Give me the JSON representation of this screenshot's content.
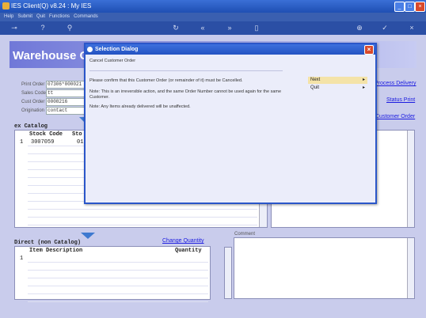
{
  "window": {
    "title": "IES Client(Q) v8.24 : My IES"
  },
  "menu": [
    "Help",
    "Submit",
    "Quit",
    "Functions",
    "Commands"
  ],
  "banner": {
    "title": "Warehouse Or"
  },
  "form": {
    "print_order_label": "Print Order",
    "print_order_value": "07306*000021",
    "sales_code_label": "Sales Code",
    "sales_code_value": "tt",
    "cust_order_label": "Cust Order",
    "cust_order_value": "0008216",
    "origination_label": "Origination",
    "origination_value": "contact"
  },
  "links": {
    "process_delivery": "Process Delivery",
    "status_print": "Status Print",
    "customer_order": "Customer Order",
    "change_quantity": "Change Quantity"
  },
  "catalog": {
    "section_label": "ex Catalog",
    "columns": [
      "Stock Code",
      "Sto"
    ],
    "rows": [
      {
        "num": "1",
        "stock_code": "3007059",
        "sto": "01"
      }
    ]
  },
  "noncatalog": {
    "section_label": "Direct (non Catalog)",
    "columns": [
      "Item Description",
      "Quantity"
    ],
    "rows": [
      {
        "num": "1"
      }
    ]
  },
  "comment": {
    "label": "Comment"
  },
  "dialog": {
    "title": "Selection Dialog",
    "subtitle": "Cancel Customer Order",
    "message1": "Please confirm that this Customer Order (or remainder of it) must be Cancelled.",
    "message2": "Note: This is an irreversible action, and the same Order Number cannot be used again for the same Customer.",
    "message3": "Note: Any Items already delivered will be unaffected.",
    "options": [
      {
        "label": "Next",
        "selected": true
      },
      {
        "label": "Quit",
        "selected": false
      }
    ]
  },
  "colors": {
    "selected_option": "#f4e3a8"
  }
}
